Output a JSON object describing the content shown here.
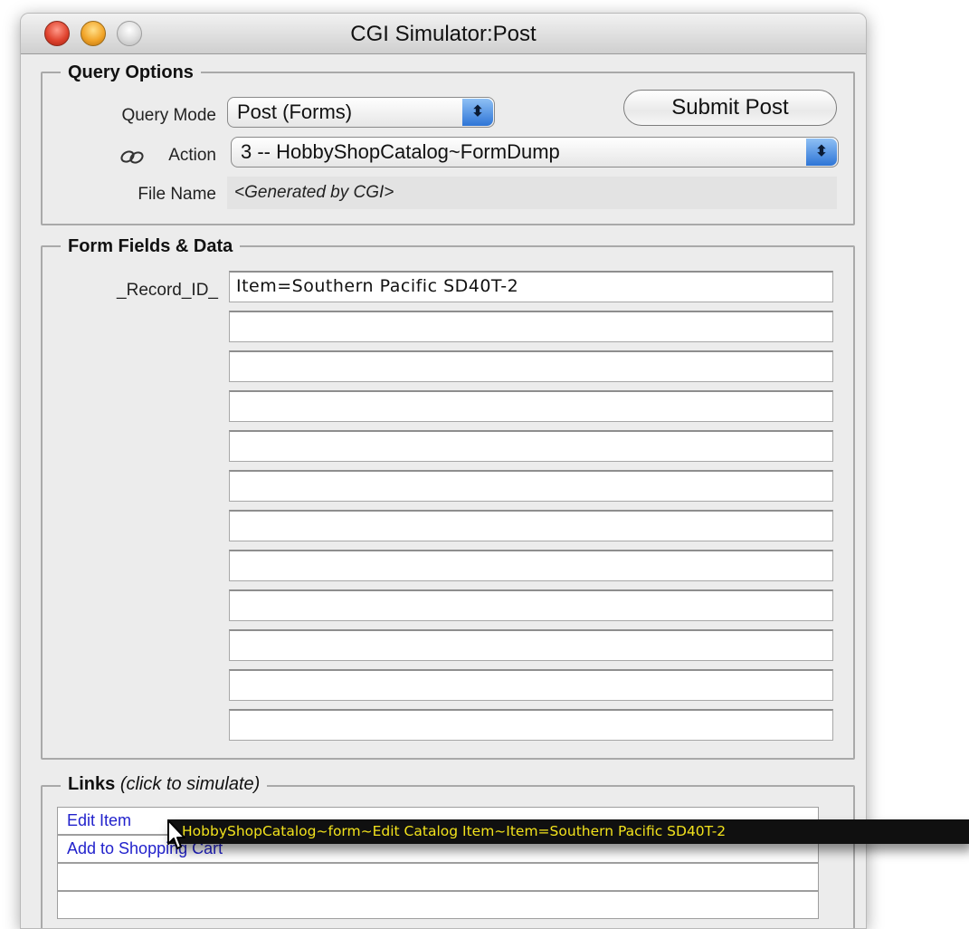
{
  "window": {
    "title": "CGI Simulator:Post"
  },
  "query_options": {
    "label": "Query Options",
    "query_mode_label": "Query Mode",
    "query_mode_value": "Post (Forms)",
    "submit_button": "Submit Post",
    "action_label": "Action",
    "action_value": "3 -- HobbyShopCatalog~FormDump",
    "file_name_label": "File Name",
    "file_name_value": "<Generated by CGI>"
  },
  "form_fields": {
    "label": "Form Fields & Data",
    "first_field_label": "_Record_ID_",
    "rows": [
      "Item=Southern Pacific SD40T-2",
      "",
      "",
      "",
      "",
      "",
      "",
      "",
      "",
      "",
      "",
      ""
    ]
  },
  "links": {
    "label": "Links",
    "hint": "(click to simulate)",
    "rows": [
      "Edit Item",
      "Add to Shopping Cart",
      "",
      ""
    ]
  },
  "tooltip": {
    "text": "HobbyShopCatalog~form~Edit Catalog Item~Item=Southern Pacific SD40T-2"
  },
  "colors": {
    "link": "#2222cc",
    "tooltip_bg": "#101010",
    "tooltip_text": "#f2e21c",
    "popup_arrow": "#2e75d6"
  }
}
